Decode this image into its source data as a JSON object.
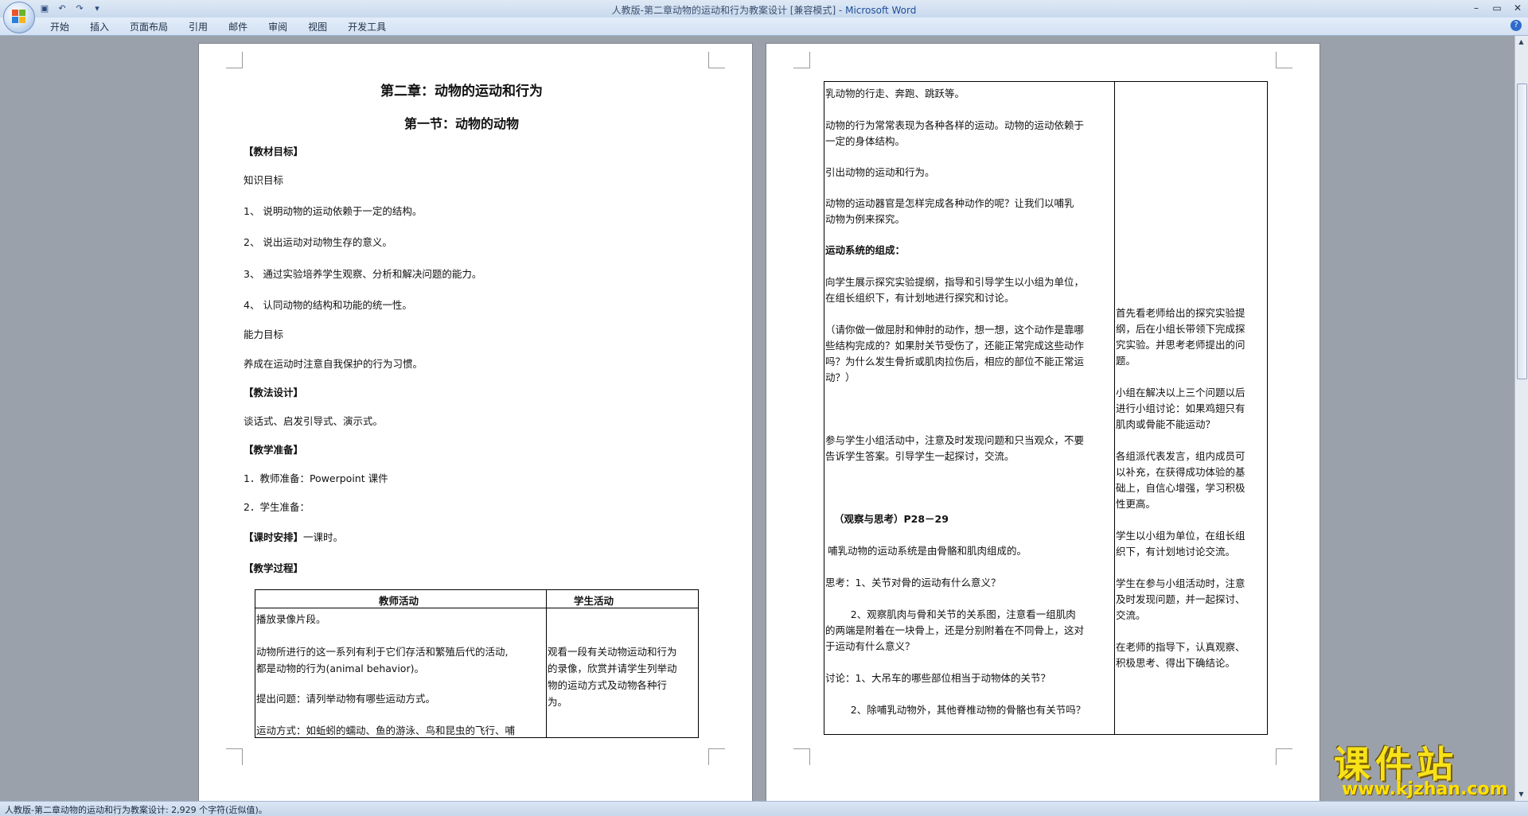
{
  "window": {
    "title": "人教版-第二章动物的运动和行为教案设计 [兼容模式] - ",
    "app_name": "Microsoft Word"
  },
  "qat": [
    "save-icon",
    "undo-icon",
    "redo-icon",
    "customize-icon"
  ],
  "ribbon": {
    "tabs": [
      "开始",
      "插入",
      "页面布局",
      "引用",
      "邮件",
      "审阅",
      "视图",
      "开发工具"
    ]
  },
  "page1": {
    "title": "第二章：动物的运动和行为",
    "subtitle": "第一节：动物的动物",
    "lines": [
      "【教材目标】",
      "知识目标",
      "1、 说明动物的运动依赖于一定的结构。",
      "2、 说出运动对动物生存的意义。",
      "3、 通过实验培养学生观察、分析和解决问题的能力。",
      "4、 认同动物的结构和功能的统一性。",
      "能力目标",
      "养成在运动时注意自我保护的行为习惯。",
      "【教法设计】",
      "谈话式、启发引导式、演示式。",
      "【教学准备】",
      "1．教师准备：Powerpoint 课件",
      "2．学生准备：",
      "【课时安排】",
      "一课时。",
      "【教学过程】"
    ],
    "table": {
      "headers": [
        "教师活动",
        "学生活动"
      ],
      "teacher": [
        "播放录像片段。",
        "动物所进行的这一系列有利于它们存活和繁殖后代的活动,",
        "都是动物的行为(animal behavior)。",
        "提出问题：请列举动物有哪些运动方式。",
        "运动方式：如蚯蚓的蠕动、鱼的游泳、鸟和昆虫的飞行、哺"
      ],
      "student": [
        "观看一段有关动物运动和行为",
        "的录像，欣赏并请学生列举动",
        "物的运动方式及动物各种行",
        "为。"
      ]
    }
  },
  "page2": {
    "teacher": [
      "乳动物的行走、奔跑、跳跃等。",
      "动物的行为常常表现为各种各样的运动。动物的运动依赖于",
      "一定的身体结构。",
      "引出动物的运动和行为。",
      "  动物的运动器官是怎样完成各种动作的呢？让我们以哺乳",
      "动物为例来探究。",
      "运动系统的组成：",
      "向学生展示探究实验提纲，指导和引导学生以小组为单位，",
      "在组长组织下，有计划地进行探究和讨论。",
      "（请你做一做屈肘和伸肘的动作，想一想，这个动作是靠哪",
      "些结构完成的？如果肘关节受伤了，还能正常完成这些动作",
      "吗？为什么发生骨折或肌肉拉伤后，相应的部位不能正常运",
      "动？）",
      "参与学生小组活动中，注意及时发现问题和只当观众，不要",
      "告诉学生答案。引导学生一起探讨，交流。",
      "（观察与思考）P28－29",
      "哺乳动物的运动系统是由骨骼和肌肉组成的。",
      "思考：1、关节对骨的运动有什么意义？",
      "        2、观察肌肉与骨和关节的关系图，注意看一组肌肉",
      "的两端是附着在一块骨上，还是分别附着在不同骨上，这对",
      "于运动有什么意义？",
      "讨论：1、大吊车的哪些部位相当于动物体的关节？",
      "        2、除哺乳动物外，其他脊椎动物的骨骼也有关节吗？"
    ],
    "student": [
      "首先看老师给出的探究实验提",
      "纲，后在小组长带领下完成探",
      "究实验。并思考老师提出的问",
      "题。",
      "小组在解决以上三个问题以后",
      "进行小组讨论：如果鸡翅只有",
      "肌肉或骨能不能运动？",
      "各组派代表发言，组内成员可",
      "以补充，在获得成功体验的基",
      "础上，自信心增强，学习积极",
      "性更高。",
      "学生以小组为单位，在组长组",
      "织下，有计划地讨论交流。",
      "学生在参与小组活动时，注意",
      "及时发现问题，并一起探讨、",
      "交流。",
      "在老师的指导下，认真观察、",
      "积极思考、得出下确结论。"
    ]
  },
  "status": {
    "text": "人教版-第二章动物的运动和行为教案设计: 2,929 个字符(近似值)。"
  },
  "watermark": {
    "cn": "课件站",
    "url": "www.kjzhan.com"
  }
}
